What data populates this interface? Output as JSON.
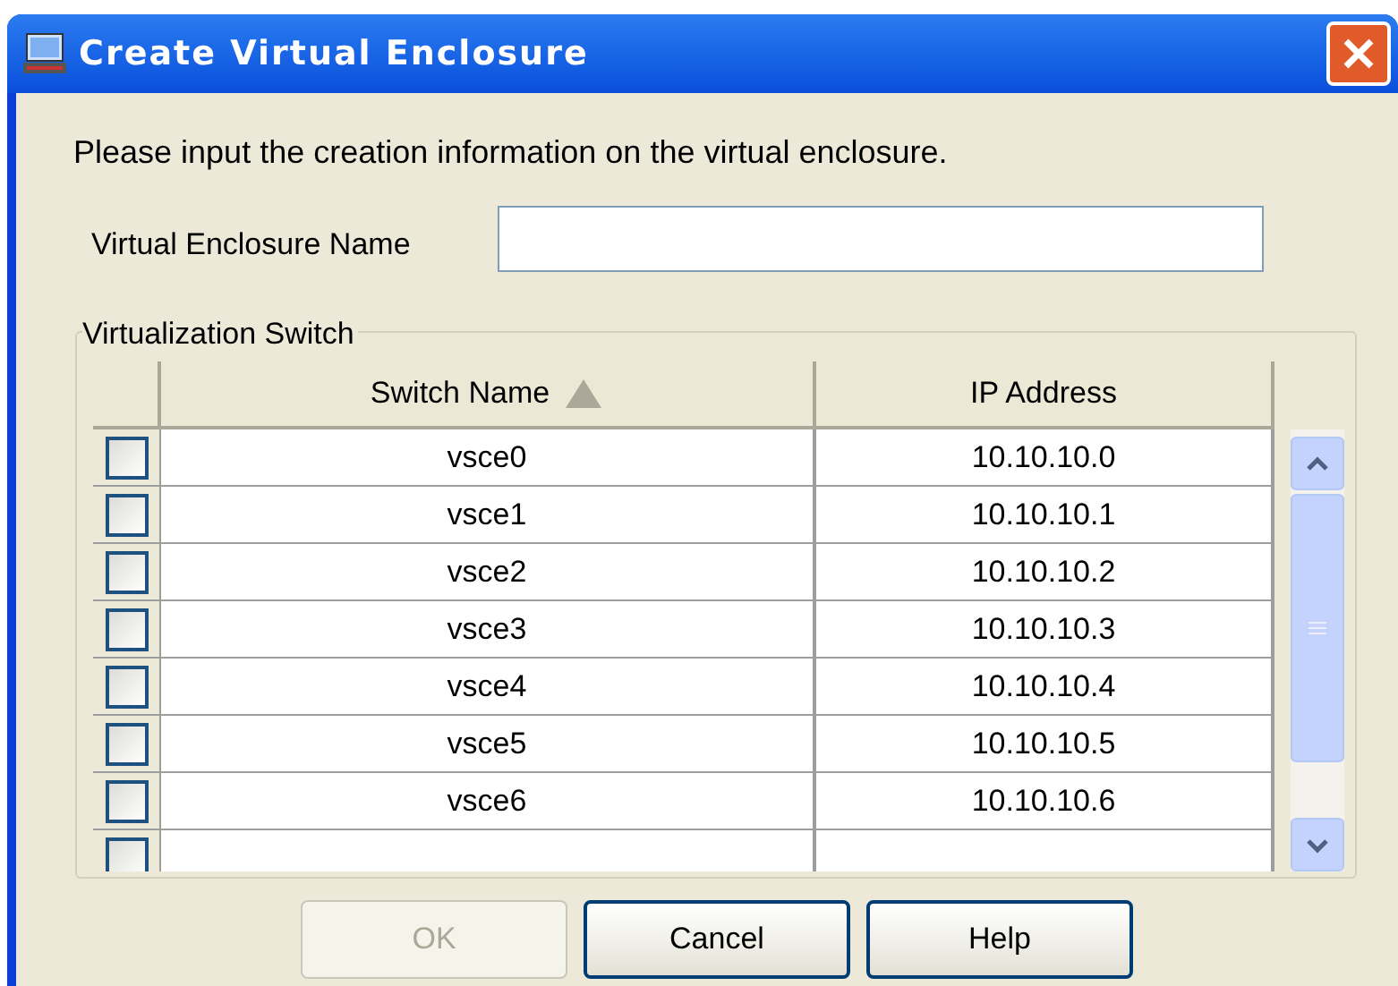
{
  "window": {
    "title": "Create Virtual Enclosure"
  },
  "message": "Please input the creation information on the virtual enclosure.",
  "name_field": {
    "label": "Virtual Enclosure Name"
  },
  "group": {
    "title": "Virtualization Switch"
  },
  "table": {
    "columns": [
      {
        "label": "Switch Name",
        "sorted": true
      },
      {
        "label": "IP Address",
        "sorted": false
      }
    ],
    "rows": [
      {
        "checked": false,
        "switch_name": "vsce0",
        "ip": "10.10.10.0"
      },
      {
        "checked": false,
        "switch_name": "vsce1",
        "ip": "10.10.10.1"
      },
      {
        "checked": false,
        "switch_name": "vsce2",
        "ip": "10.10.10.2"
      },
      {
        "checked": false,
        "switch_name": "vsce3",
        "ip": "10.10.10.3"
      },
      {
        "checked": false,
        "switch_name": "vsce4",
        "ip": "10.10.10.4"
      },
      {
        "checked": false,
        "switch_name": "vsce5",
        "ip": "10.10.10.5"
      },
      {
        "checked": false,
        "switch_name": "vsce6",
        "ip": "10.10.10.6"
      },
      {
        "checked": false
      }
    ]
  },
  "buttons": [
    {
      "label": "OK",
      "disabled": true
    },
    {
      "label": "Cancel",
      "disabled": false
    },
    {
      "label": "Help",
      "disabled": false
    }
  ]
}
